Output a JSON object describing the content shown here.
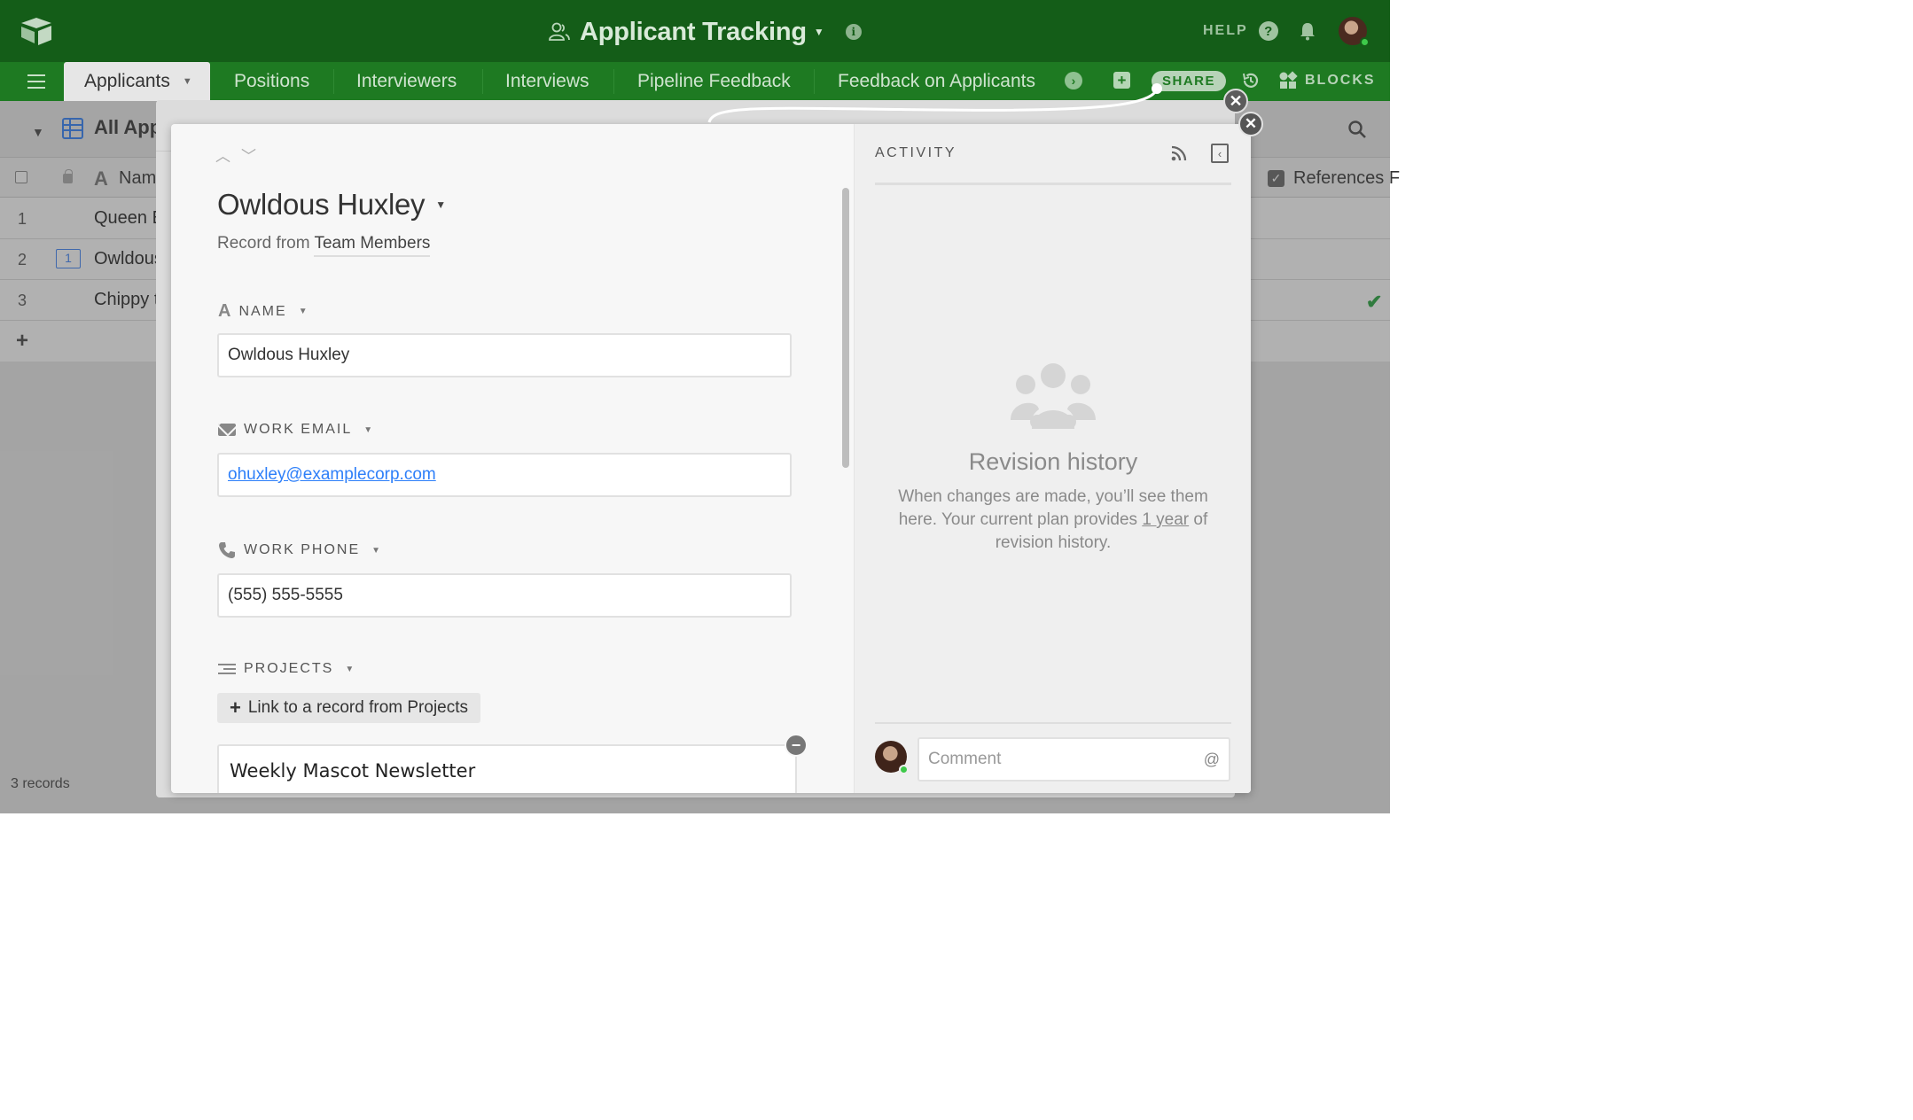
{
  "topbar": {
    "base_title": "Applicant Tracking",
    "help_label": "HELP",
    "help_glyph": "?"
  },
  "tabs": [
    {
      "label": "Applicants"
    },
    {
      "label": "Positions"
    },
    {
      "label": "Interviewers"
    },
    {
      "label": "Interviews"
    },
    {
      "label": "Pipeline Feedback"
    },
    {
      "label": "Feedback on Applicants"
    }
  ],
  "toolbar": {
    "share_label": "SHARE",
    "blocks_label": "BLOCKS"
  },
  "grid": {
    "view_name": "All App",
    "name_column": "Name",
    "references_column": "References F",
    "rows": [
      {
        "num": "1",
        "value": "Queen E"
      },
      {
        "num": "2",
        "value": "Owldous",
        "comment_count": "1"
      },
      {
        "num": "3",
        "value": "Chippy t"
      }
    ],
    "add_row": "+",
    "record_count": "3 records"
  },
  "record": {
    "title": "Owldous Huxley",
    "from_prefix": "Record from",
    "from_table": "Team Members",
    "fields": {
      "name": {
        "label": "NAME",
        "value": "Owldous Huxley"
      },
      "work_email": {
        "label": "WORK EMAIL",
        "value": "ohuxley@examplecorp.com"
      },
      "work_phone": {
        "label": "WORK PHONE",
        "value": "(555) 555-5555"
      },
      "projects": {
        "label": "PROJECTS",
        "link_button": "Link to a record from Projects",
        "linked_records": [
          "Weekly Mascot Newsletter"
        ]
      }
    }
  },
  "activity": {
    "title": "ACTIVITY",
    "empty_title": "Revision history",
    "empty_text_1": "When changes are made, you’ll see them here. Your current plan provides",
    "empty_link": "1 year",
    "empty_text_2": "of revision history.",
    "comment_placeholder": "Comment",
    "mention_glyph": "@"
  },
  "colors": {
    "topbar_bg": "#145d18",
    "tabs_bg": "#1e7a22",
    "link_blue": "#2d7ff9",
    "check_green": "#22a33a"
  },
  "icons": [
    "airtable-logo-icon",
    "team-icon",
    "info-icon",
    "help-icon",
    "bell-icon",
    "user-avatar",
    "menu-icon",
    "chevron-down-icon",
    "history-icon",
    "blocks-icon",
    "grid-view-icon",
    "search-icon",
    "close-icon",
    "text-field-icon",
    "email-icon",
    "phone-icon",
    "linked-records-icon",
    "rss-icon",
    "collapse-panel-icon",
    "people-icon"
  ]
}
